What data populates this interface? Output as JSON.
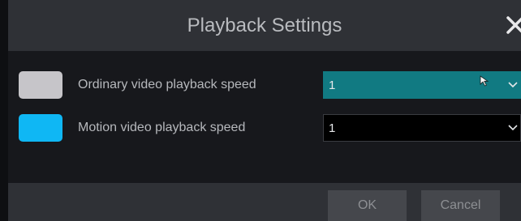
{
  "dialog": {
    "title": "Playback Settings",
    "close_icon": "close-icon"
  },
  "settings": [
    {
      "label": "Ordinary video playback speed",
      "value": "1",
      "swatch_color": "#c6c5c9",
      "select_bg": "#117a82"
    },
    {
      "label": "Motion video playback speed",
      "value": "1",
      "swatch_color": "#0fb7f4",
      "select_bg": "#000000"
    }
  ],
  "footer": {
    "ok_label": "OK",
    "cancel_label": "Cancel"
  },
  "icons": {
    "dropdown": "chevron-down-icon",
    "pointer": "mouse-pointer-icon"
  }
}
